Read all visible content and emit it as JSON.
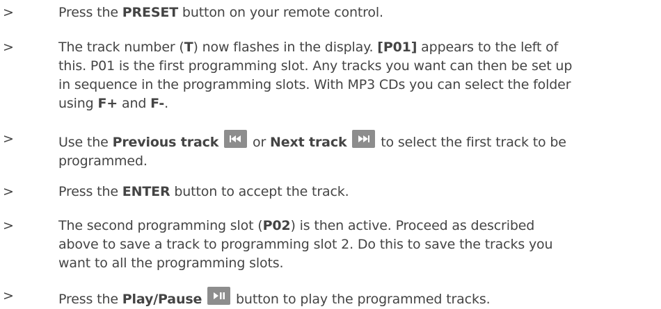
{
  "marker": ">",
  "steps": [
    {
      "p1": "Press the ",
      "b1": "PRESET",
      "p2": " button on your remote control."
    },
    {
      "l1_p1": "The track number (",
      "l1_b1": "T",
      "l1_p2": ") now flashes in the display. ",
      "l1_b2": "[P01]",
      "l1_p3": " appears to the left of",
      "l2": "this. P01 is the first programming slot. Any tracks you want can then be set up",
      "l3": "in sequence in the programming slots. With MP3 CDs you can select the folder",
      "l4_p1": "using ",
      "l4_b1": "F+",
      "l4_p2": " and ",
      "l4_b2": "F-",
      "l4_p3": "."
    },
    {
      "p1": "Use the ",
      "b1": "Previous track",
      "p2": " or ",
      "b2": "Next track",
      "p3": " to select the first track to be",
      "l2": "programmed.",
      "icon1": "previous-track-icon",
      "icon2": "next-track-icon"
    },
    {
      "p1": "Press the ",
      "b1": "ENTER",
      "p2": " button to accept the track."
    },
    {
      "l1_p1": "The second programming slot (",
      "l1_b1": "P02",
      "l1_p2": ") is then active. Proceed as described",
      "l2": "above to save a track to programming slot 2. Do this to save the tracks you",
      "l3": "want to all the programming slots."
    },
    {
      "p1": "Press the ",
      "b1": "Play/Pause",
      "p2": " button to play the programmed tracks.",
      "icon1": "play-pause-icon"
    }
  ],
  "colors": {
    "text": "#444444",
    "icon_bg": "#8d8d8d",
    "icon_fg": "#ffffff"
  }
}
